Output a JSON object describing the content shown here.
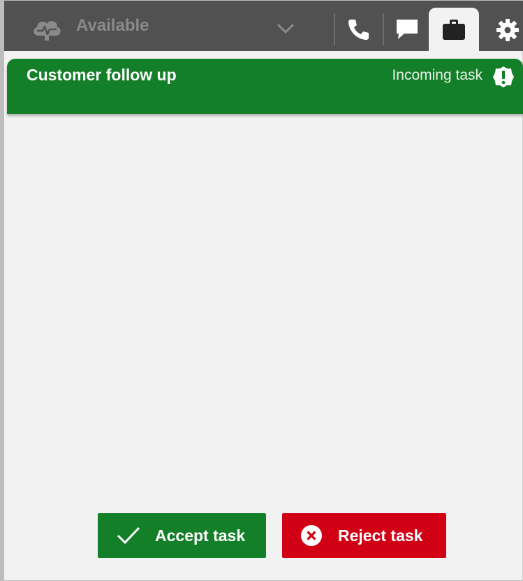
{
  "topbar": {
    "status_label": "Available",
    "icons": {
      "status": "cloud-heartbeat-icon",
      "dropdown": "chevron-down-icon",
      "phone": "phone-icon",
      "chat": "chat-icon",
      "tasks": "briefcase-icon",
      "settings": "gear-icon"
    }
  },
  "task": {
    "title": "Customer follow up",
    "status": "Incoming task",
    "status_icon": "alert-icon"
  },
  "actions": {
    "accept_label": "Accept task",
    "reject_label": "Reject task"
  },
  "colors": {
    "accept": "#147f29",
    "reject": "#d10015",
    "topbar": "#515151"
  }
}
